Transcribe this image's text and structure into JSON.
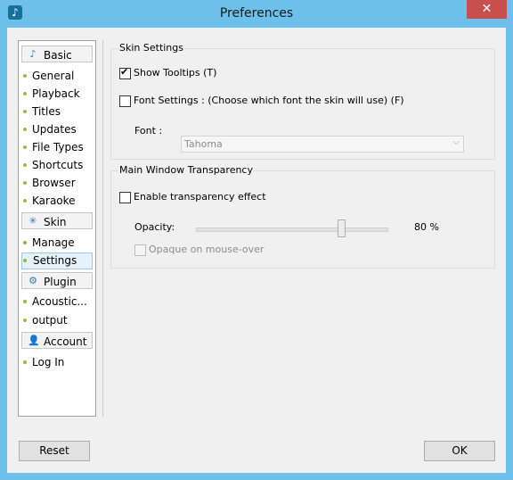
{
  "window": {
    "title": "Preferences",
    "app_icon": "music-note-icon",
    "close_glyph": "✕"
  },
  "sidebar": {
    "categories": [
      {
        "label": "Basic",
        "icon": "music-note-icon",
        "glyph": "♪"
      },
      {
        "label": "Skin",
        "icon": "magic-wand-icon",
        "glyph": "✳"
      },
      {
        "label": "Plugin",
        "icon": "gear-icon",
        "glyph": "⚙"
      },
      {
        "label": "Account",
        "icon": "user-icon",
        "glyph": "👤"
      }
    ],
    "basic_items": [
      "General",
      "Playback",
      "Titles",
      "Updates",
      "File Types",
      "Shortcuts",
      "Browser",
      "Karaoke"
    ],
    "skin_items": [
      "Manage",
      "Settings"
    ],
    "plugin_items": [
      "Acoustic...",
      "output"
    ],
    "account_items": [
      "Log In"
    ],
    "selected": "Settings"
  },
  "skin_settings": {
    "legend": "Skin Settings",
    "show_tooltips": {
      "label": "Show Tooltips (T)",
      "checked": true
    },
    "font_settings": {
      "label": "Font Settings : (Choose which font the skin will use) (F)",
      "checked": false
    },
    "font_label": "Font :",
    "font_value": "Tahoma"
  },
  "transparency": {
    "legend": "Main Window Transparency",
    "enable": {
      "label": "Enable transparency effect",
      "checked": false
    },
    "opacity_label": "Opacity:",
    "opacity_value_text": "80 %",
    "opacity_percent": 80,
    "opaque_on_mouseover": {
      "label": "Opaque on mouse-over",
      "checked": false,
      "disabled": true
    }
  },
  "buttons": {
    "reset": "Reset",
    "ok": "OK"
  },
  "colors": {
    "title_bar": "#6dc0e9",
    "close_button": "#c7504f",
    "selection": "#e5f1fb",
    "bullet": "#8cbf3f"
  }
}
